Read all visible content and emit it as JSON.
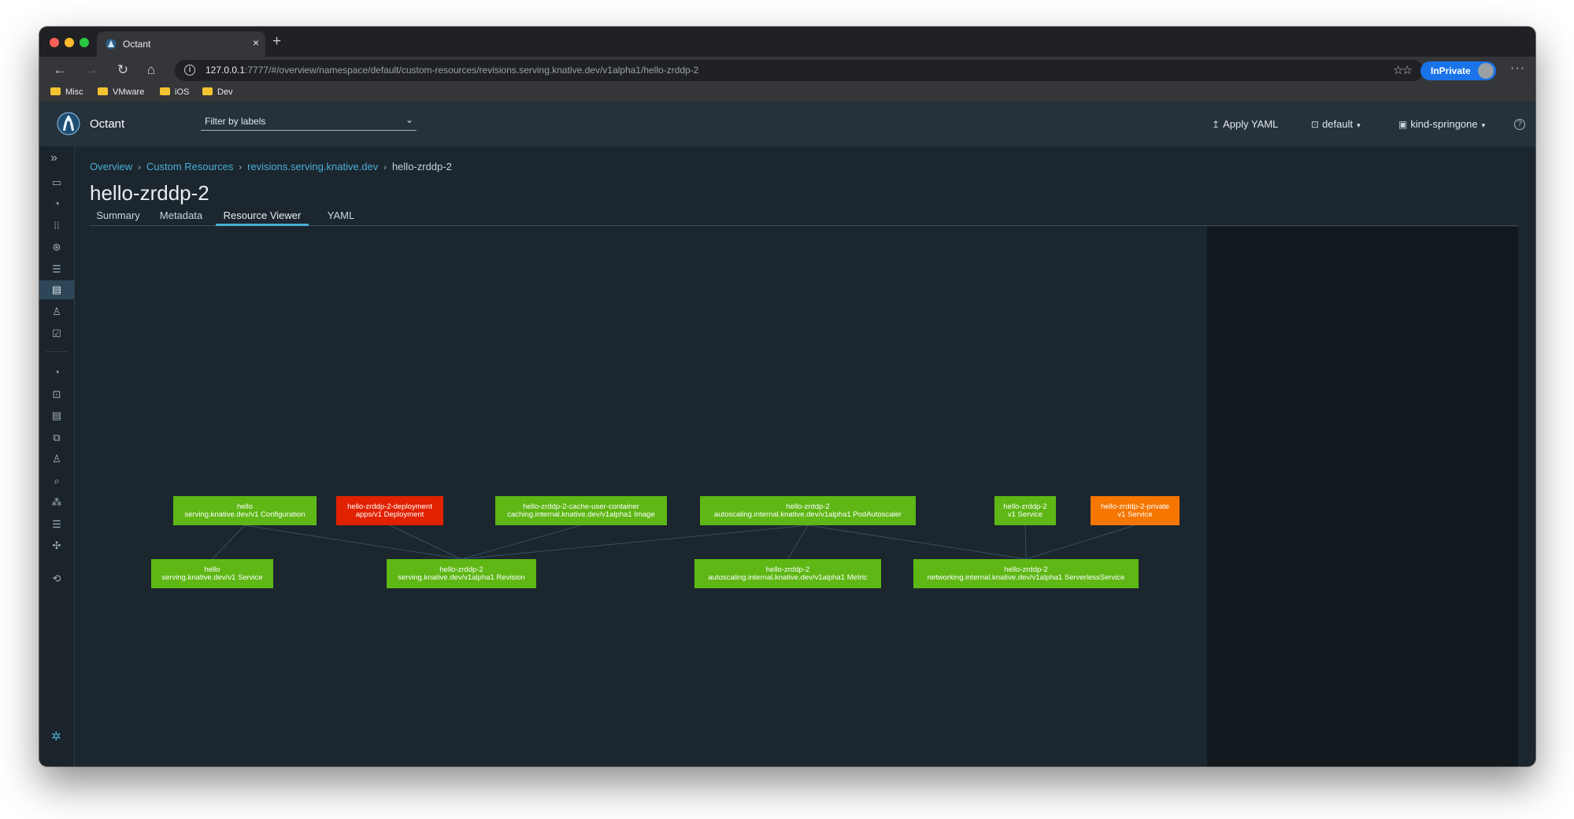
{
  "browser": {
    "tab_title": "Octant",
    "new_tab": "+",
    "tab_close": "×",
    "url_host": "127.0.0.1",
    "url_rest": ":7777/#/overview/namespace/default/custom-resources/revisions.serving.knative.dev/v1alpha1/hello-zrddp-2",
    "inprivate_label": "InPrivate",
    "bookmarks": [
      "Misc",
      "VMware",
      "iOS",
      "Dev"
    ],
    "accent": "#1a73e8"
  },
  "header": {
    "app_name": "Octant",
    "filter_placeholder": "Filter by labels",
    "apply_yaml": "Apply YAML",
    "namespace": "default",
    "context": "kind-springone"
  },
  "sidenav": {
    "icons": [
      "overview-icon",
      "dashboard-icon",
      "workloads-grid-icon",
      "discovery-icon",
      "config-storage-icon",
      "custom-resources-icon",
      "rbac-icon",
      "events-icon",
      "cluster-overview-icon",
      "namespaces-icon",
      "cluster-custom-resources-icon",
      "nodes-icon",
      "cluster-rbac-icon",
      "port-forwards-icon",
      "plugins-icon",
      "storage-icon",
      "api-icon",
      "extension-icon",
      "settings-icon"
    ]
  },
  "breadcrumb": {
    "items": [
      "Overview",
      "Custom Resources",
      "revisions.serving.knative.dev"
    ],
    "current": "hello-zrddp-2"
  },
  "page": {
    "title": "hello-zrddp-2",
    "tabs": [
      "Summary",
      "Metadata",
      "Resource Viewer",
      "YAML"
    ],
    "active_tab": "Resource Viewer"
  },
  "graph": {
    "status_colors": {
      "ok": "#5eb715",
      "error": "#e12200",
      "warning": "#f57600"
    },
    "nodes": [
      {
        "id": "config",
        "line1": "hello",
        "line2": "serving.knative.dev/v1 Configuration",
        "status": "ok"
      },
      {
        "id": "deployment",
        "line1": "hello-zrddp-2-deployment",
        "line2": "apps/v1 Deployment",
        "status": "error"
      },
      {
        "id": "image",
        "line1": "hello-zrddp-2-cache-user-container",
        "line2": "caching.internal.knative.dev/v1alpha1 Image",
        "status": "ok"
      },
      {
        "id": "pa",
        "line1": "hello-zrddp-2",
        "line2": "autoscaling.internal.knative.dev/v1alpha1 PodAutoscaler",
        "status": "ok"
      },
      {
        "id": "svc1",
        "line1": "hello-zrddp-2",
        "line2": "v1 Service",
        "status": "ok"
      },
      {
        "id": "svcpriv",
        "line1": "hello-zrddp-2-private",
        "line2": "v1 Service",
        "status": "warning"
      },
      {
        "id": "kservice",
        "line1": "hello",
        "line2": "serving.knative.dev/v1 Service",
        "status": "ok"
      },
      {
        "id": "revision",
        "line1": "hello-zrddp-2",
        "line2": "serving.knative.dev/v1alpha1 Revision",
        "status": "ok"
      },
      {
        "id": "metric",
        "line1": "hello-zrddp-2",
        "line2": "autoscaling.internal.knative.dev/v1alpha1 Metric",
        "status": "ok"
      },
      {
        "id": "sks",
        "line1": "hello-zrddp-2",
        "line2": "networking.internal.knative.dev/v1alpha1 ServerlessService",
        "status": "ok"
      }
    ],
    "edges": [
      [
        "config",
        "kservice"
      ],
      [
        "config",
        "revision"
      ],
      [
        "deployment",
        "revision"
      ],
      [
        "image",
        "revision"
      ],
      [
        "pa",
        "revision"
      ],
      [
        "pa",
        "metric"
      ],
      [
        "pa",
        "sks"
      ],
      [
        "svc1",
        "sks"
      ],
      [
        "svcpriv",
        "sks"
      ]
    ]
  }
}
